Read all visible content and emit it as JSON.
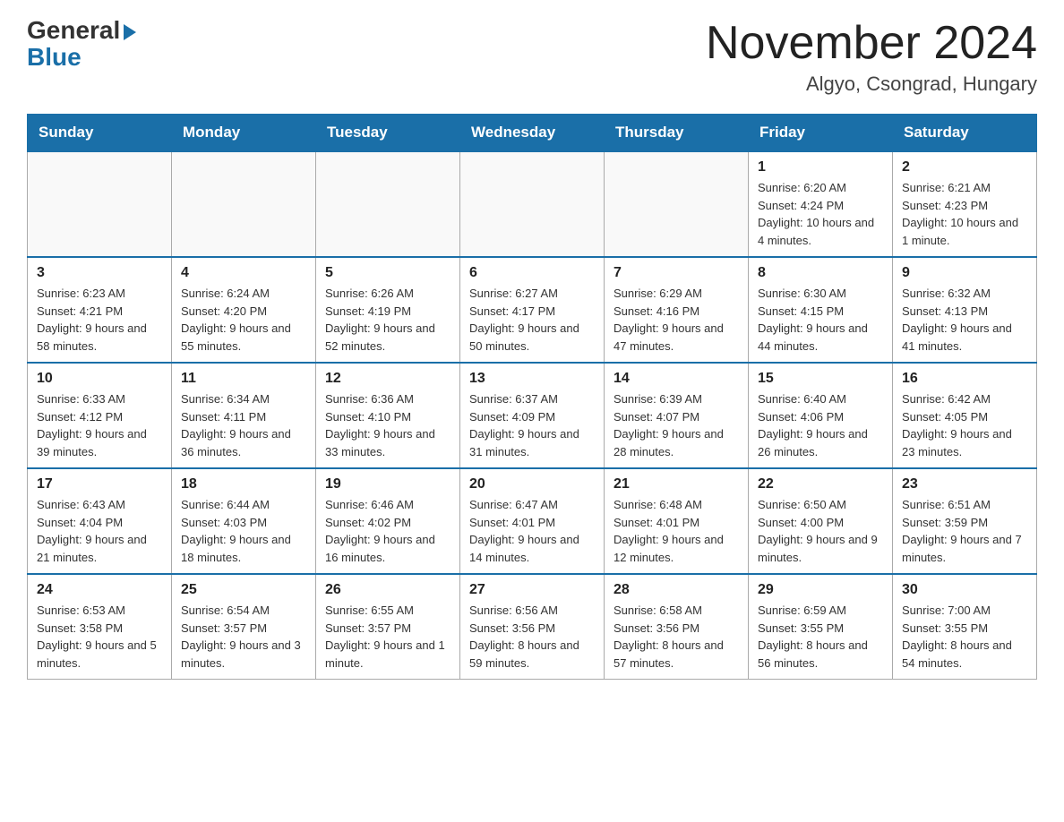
{
  "logo": {
    "general": "General",
    "blue": "Blue"
  },
  "title": "November 2024",
  "subtitle": "Algyo, Csongrad, Hungary",
  "headers": [
    "Sunday",
    "Monday",
    "Tuesday",
    "Wednesday",
    "Thursday",
    "Friday",
    "Saturday"
  ],
  "weeks": [
    [
      {
        "day": "",
        "info": ""
      },
      {
        "day": "",
        "info": ""
      },
      {
        "day": "",
        "info": ""
      },
      {
        "day": "",
        "info": ""
      },
      {
        "day": "",
        "info": ""
      },
      {
        "day": "1",
        "info": "Sunrise: 6:20 AM\nSunset: 4:24 PM\nDaylight: 10 hours and 4 minutes."
      },
      {
        "day": "2",
        "info": "Sunrise: 6:21 AM\nSunset: 4:23 PM\nDaylight: 10 hours and 1 minute."
      }
    ],
    [
      {
        "day": "3",
        "info": "Sunrise: 6:23 AM\nSunset: 4:21 PM\nDaylight: 9 hours and 58 minutes."
      },
      {
        "day": "4",
        "info": "Sunrise: 6:24 AM\nSunset: 4:20 PM\nDaylight: 9 hours and 55 minutes."
      },
      {
        "day": "5",
        "info": "Sunrise: 6:26 AM\nSunset: 4:19 PM\nDaylight: 9 hours and 52 minutes."
      },
      {
        "day": "6",
        "info": "Sunrise: 6:27 AM\nSunset: 4:17 PM\nDaylight: 9 hours and 50 minutes."
      },
      {
        "day": "7",
        "info": "Sunrise: 6:29 AM\nSunset: 4:16 PM\nDaylight: 9 hours and 47 minutes."
      },
      {
        "day": "8",
        "info": "Sunrise: 6:30 AM\nSunset: 4:15 PM\nDaylight: 9 hours and 44 minutes."
      },
      {
        "day": "9",
        "info": "Sunrise: 6:32 AM\nSunset: 4:13 PM\nDaylight: 9 hours and 41 minutes."
      }
    ],
    [
      {
        "day": "10",
        "info": "Sunrise: 6:33 AM\nSunset: 4:12 PM\nDaylight: 9 hours and 39 minutes."
      },
      {
        "day": "11",
        "info": "Sunrise: 6:34 AM\nSunset: 4:11 PM\nDaylight: 9 hours and 36 minutes."
      },
      {
        "day": "12",
        "info": "Sunrise: 6:36 AM\nSunset: 4:10 PM\nDaylight: 9 hours and 33 minutes."
      },
      {
        "day": "13",
        "info": "Sunrise: 6:37 AM\nSunset: 4:09 PM\nDaylight: 9 hours and 31 minutes."
      },
      {
        "day": "14",
        "info": "Sunrise: 6:39 AM\nSunset: 4:07 PM\nDaylight: 9 hours and 28 minutes."
      },
      {
        "day": "15",
        "info": "Sunrise: 6:40 AM\nSunset: 4:06 PM\nDaylight: 9 hours and 26 minutes."
      },
      {
        "day": "16",
        "info": "Sunrise: 6:42 AM\nSunset: 4:05 PM\nDaylight: 9 hours and 23 minutes."
      }
    ],
    [
      {
        "day": "17",
        "info": "Sunrise: 6:43 AM\nSunset: 4:04 PM\nDaylight: 9 hours and 21 minutes."
      },
      {
        "day": "18",
        "info": "Sunrise: 6:44 AM\nSunset: 4:03 PM\nDaylight: 9 hours and 18 minutes."
      },
      {
        "day": "19",
        "info": "Sunrise: 6:46 AM\nSunset: 4:02 PM\nDaylight: 9 hours and 16 minutes."
      },
      {
        "day": "20",
        "info": "Sunrise: 6:47 AM\nSunset: 4:01 PM\nDaylight: 9 hours and 14 minutes."
      },
      {
        "day": "21",
        "info": "Sunrise: 6:48 AM\nSunset: 4:01 PM\nDaylight: 9 hours and 12 minutes."
      },
      {
        "day": "22",
        "info": "Sunrise: 6:50 AM\nSunset: 4:00 PM\nDaylight: 9 hours and 9 minutes."
      },
      {
        "day": "23",
        "info": "Sunrise: 6:51 AM\nSunset: 3:59 PM\nDaylight: 9 hours and 7 minutes."
      }
    ],
    [
      {
        "day": "24",
        "info": "Sunrise: 6:53 AM\nSunset: 3:58 PM\nDaylight: 9 hours and 5 minutes."
      },
      {
        "day": "25",
        "info": "Sunrise: 6:54 AM\nSunset: 3:57 PM\nDaylight: 9 hours and 3 minutes."
      },
      {
        "day": "26",
        "info": "Sunrise: 6:55 AM\nSunset: 3:57 PM\nDaylight: 9 hours and 1 minute."
      },
      {
        "day": "27",
        "info": "Sunrise: 6:56 AM\nSunset: 3:56 PM\nDaylight: 8 hours and 59 minutes."
      },
      {
        "day": "28",
        "info": "Sunrise: 6:58 AM\nSunset: 3:56 PM\nDaylight: 8 hours and 57 minutes."
      },
      {
        "day": "29",
        "info": "Sunrise: 6:59 AM\nSunset: 3:55 PM\nDaylight: 8 hours and 56 minutes."
      },
      {
        "day": "30",
        "info": "Sunrise: 7:00 AM\nSunset: 3:55 PM\nDaylight: 8 hours and 54 minutes."
      }
    ]
  ]
}
